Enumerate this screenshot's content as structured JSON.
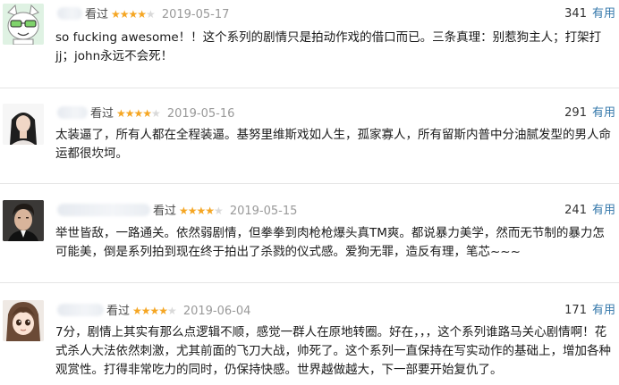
{
  "reviews": [
    {
      "watched": "看过",
      "rating": 4,
      "date": "2019-05-17",
      "votes": "341",
      "useful_label": "有用",
      "text": "so fucking awesome！！这个系列的剧情只是拍动作戏的借口而已。三条真理：别惹狗主人；打架打jj；john永远不会死！"
    },
    {
      "watched": "看过",
      "rating": 4,
      "date": "2019-05-16",
      "votes": "291",
      "useful_label": "有用",
      "text": "太装逼了，所有人都在全程装逼。基努里维斯戏如人生，孤家寡人，所有留斯内普中分油腻发型的男人命运都很坎坷。"
    },
    {
      "watched": "看过",
      "rating": 4,
      "date": "2019-05-15",
      "votes": "241",
      "useful_label": "有用",
      "text": "举世皆敌，一路通关。依然弱剧情，但拳拳到肉枪枪爆头真TM爽。都说暴力美学，然而无节制的暴力怎可能美，倒是系列拍到现在终于拍出了杀戮的仪式感。爱狗无罪，造反有理，笔芯~~~"
    },
    {
      "watched": "看过",
      "rating": 4,
      "date": "2019-06-04",
      "votes": "171",
      "useful_label": "有用",
      "text": "7分，剧情上其实有那么点逻辑不顺，感觉一群人在原地转圈。好在，，，这个系列谁路马关心剧情啊！花式杀人大法依然刺激，尤其前面的飞刀大战，帅死了。这个系列一直保持在写实动作的基础上，增加各种观赏性。打得非常吃力的同时，仍保持快感。世界越做越大，下一部要开始复仇了。"
    }
  ],
  "star_icon": "star-icon",
  "colors": {
    "star": "#f5a623",
    "useful": "#3377aa",
    "date": "#999999"
  }
}
